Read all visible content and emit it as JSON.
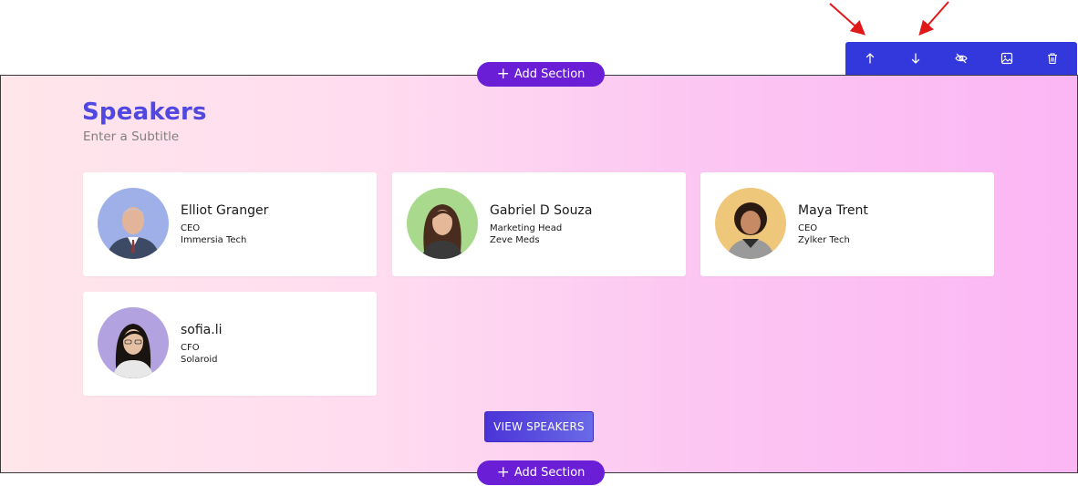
{
  "toolbar": {
    "buttons": [
      {
        "icon": "arrow-up-icon"
      },
      {
        "icon": "arrow-down-icon"
      },
      {
        "icon": "eye-off-icon"
      },
      {
        "icon": "image-icon"
      },
      {
        "icon": "trash-icon"
      }
    ],
    "annotation_color": "#e01818"
  },
  "add_section": {
    "label": "Add Section"
  },
  "section": {
    "title": "Speakers",
    "subtitle": "Enter a Subtitle",
    "title_color": "#5048e0"
  },
  "speakers": [
    {
      "name": "Elliot Granger",
      "role": "CEO",
      "org": "Immersia Tech",
      "avatar_bg": "#9fb0e8"
    },
    {
      "name": "Gabriel D Souza",
      "role": "Marketing Head",
      "org": "Zeve Meds",
      "avatar_bg": "#a9d98c"
    },
    {
      "name": "Maya Trent",
      "role": "CEO",
      "org": "Zylker Tech",
      "avatar_bg": "#efc77a"
    },
    {
      "name": "sofia.li",
      "role": "CFO",
      "org": "Solaroid",
      "avatar_bg": "#b3a2e0"
    }
  ],
  "view_button": {
    "label": "VIEW SPEAKERS"
  },
  "colors": {
    "accent": "#6a1fd6",
    "toolbar": "#3338dc"
  }
}
